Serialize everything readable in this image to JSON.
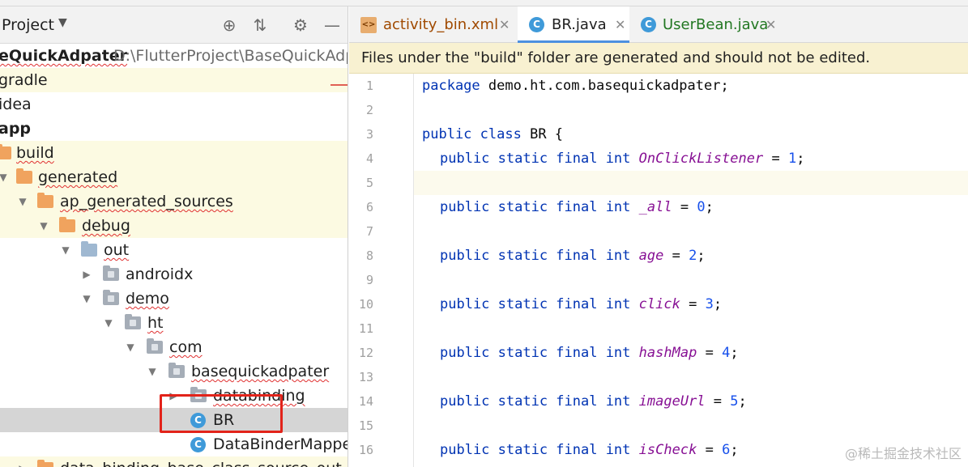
{
  "project_panel": {
    "title": "Project",
    "tree": [
      {
        "label": "eQuickAdpater",
        "path": "D:\\FlutterProject\\BaseQuickAdpat",
        "bold": true
      },
      {
        "label": "gradle"
      },
      {
        "label": "idea"
      },
      {
        "label": "app",
        "bold": true
      },
      {
        "label": "build"
      },
      {
        "label": "generated"
      },
      {
        "label": "ap_generated_sources"
      },
      {
        "label": "debug"
      },
      {
        "label": "out"
      },
      {
        "label": "androidx"
      },
      {
        "label": "demo"
      },
      {
        "label": "ht"
      },
      {
        "label": "com"
      },
      {
        "label": "basequickadpater"
      },
      {
        "label": "databinding"
      },
      {
        "label": "BR"
      },
      {
        "label": "DataBinderMapper"
      },
      {
        "label": "data_binding_base_class_source_out"
      }
    ]
  },
  "editor": {
    "tabs": [
      {
        "label": "activity_bin.xml",
        "icon": "xml-file-icon",
        "active": false
      },
      {
        "label": "BR.java",
        "icon": "class-icon",
        "active": true
      },
      {
        "label": "UserBean.java",
        "icon": "class-icon",
        "active": false
      }
    ],
    "notice": "Files under the \"build\" folder are generated and should not be edited.",
    "line_numbers": [
      "1",
      "2",
      "3",
      "4",
      "5",
      "6",
      "7",
      "8",
      "9",
      "10",
      "11",
      "12",
      "13",
      "14",
      "15",
      "16"
    ],
    "code": {
      "package_kw": "package",
      "package_name": "demo.ht.com.basequickadpater;",
      "class_decl_kw": "public class",
      "class_name": "BR {",
      "field_modifiers": "public static final int",
      "fields": [
        {
          "name": "OnClickListener",
          "value": "1"
        },
        {
          "name": "_all",
          "value": "0"
        },
        {
          "name": "age",
          "value": "2"
        },
        {
          "name": "click",
          "value": "3"
        },
        {
          "name": "hashMap",
          "value": "4"
        },
        {
          "name": "imageUrl",
          "value": "5"
        },
        {
          "name": "isCheck",
          "value": "6"
        }
      ]
    }
  },
  "watermark": "@稀土掘金技术社区",
  "colors": {
    "accent": "#4d90e0",
    "selection_box": "#e2231a",
    "keyword": "#0033b3",
    "field": "#871094",
    "number": "#1750eb",
    "notice_bg": "#f8f1d1",
    "folder_orange": "#f0a35e",
    "class_icon": "#3f9ad9"
  }
}
